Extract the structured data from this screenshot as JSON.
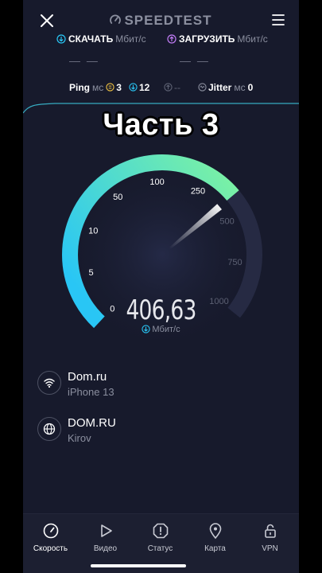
{
  "header": {
    "logo_text": "SPEEDTEST",
    "download": {
      "label": "СКАЧАТЬ",
      "unit": "Мбит/с",
      "value": "— —"
    },
    "upload": {
      "label": "ЗАГРУЗИТЬ",
      "unit": "Мбит/с",
      "value": "— —"
    }
  },
  "ping": {
    "label": "Ping",
    "unit": "мс",
    "idle": "3",
    "download": "12",
    "upload": "--",
    "jitter_label": "Jitter",
    "jitter": "0"
  },
  "caption": "Часть 3",
  "gauge": {
    "ticks": [
      "0",
      "5",
      "10",
      "50",
      "100",
      "250",
      "500",
      "750",
      "1000"
    ],
    "max": "1000",
    "value": 406.63,
    "speed_text": "406,63",
    "unit": "Мбит/с",
    "colors": {
      "start": "#29c6f5",
      "end": "#7cf2a3",
      "track": "#262a43"
    }
  },
  "providers": [
    {
      "name": "Dom.ru",
      "detail": "iPhone 13",
      "icon": "wifi-icon"
    },
    {
      "name": "DOM.RU",
      "detail": "Kirov",
      "icon": "globe-icon"
    }
  ],
  "tabs": [
    {
      "label": "Скорость",
      "icon": "speedometer-icon",
      "active": true
    },
    {
      "label": "Видео",
      "icon": "play-icon"
    },
    {
      "label": "Статус",
      "icon": "alert-icon"
    },
    {
      "label": "Карта",
      "icon": "map-pin-icon"
    },
    {
      "label": "VPN",
      "icon": "lock-icon"
    }
  ]
}
